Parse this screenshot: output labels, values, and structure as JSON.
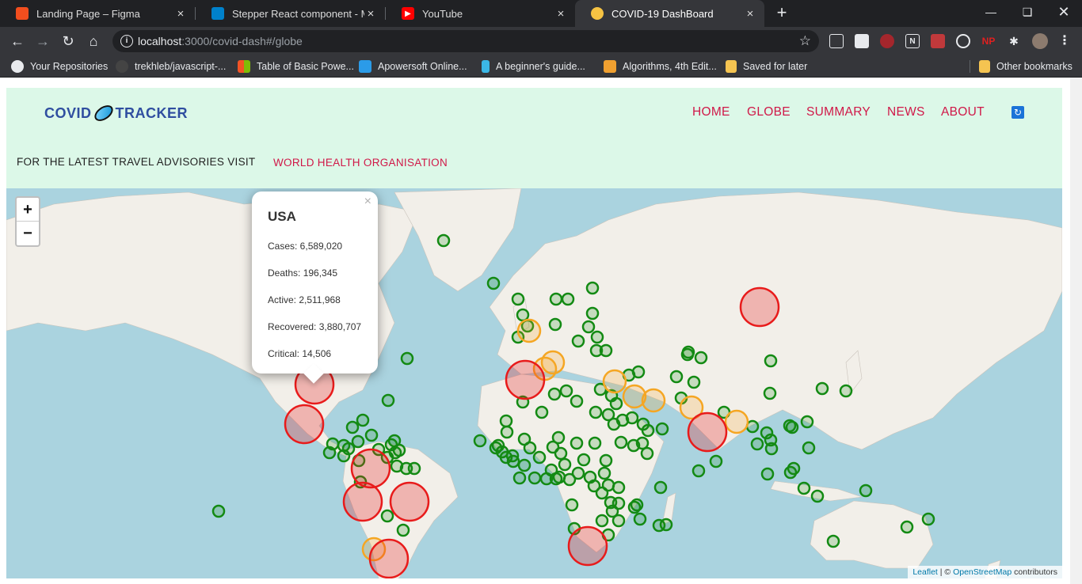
{
  "browser": {
    "tabs": [
      {
        "title": "Landing Page – Figma",
        "icon": "figma-icon",
        "color": "#f24e1e"
      },
      {
        "title": "Stepper React component - Mate",
        "icon": "material-ui-icon",
        "color": "#0081cb"
      },
      {
        "title": "YouTube",
        "icon": "youtube-icon",
        "color": "#ff0000"
      },
      {
        "title": "COVID-19 DashBoard",
        "icon": "mask-emoji-icon",
        "color": "#f6c343",
        "active": true
      }
    ],
    "close_glyph": "×",
    "new_tab_glyph": "+",
    "url_host": "localhost",
    "url_rest": ":3000/covid-dash#/globe"
  },
  "bookmarks": [
    {
      "label": "Your Repositories",
      "icon": "github-icon",
      "color": "#e8eaed"
    },
    {
      "label": "trekhleb/javascript-...",
      "icon": "github-icon",
      "color": "#e8eaed"
    },
    {
      "label": "Table of Basic Powe...",
      "icon": "microsoft-icon",
      "color": "#f35325"
    },
    {
      "label": "Apowersoft Online...",
      "icon": "camera-icon",
      "color": "#2b9be8"
    },
    {
      "label": "A beginner's guide...",
      "icon": "bottle-icon",
      "color": "#3bb7e6"
    },
    {
      "label": "Algorithms, 4th Edit...",
      "icon": "cat-icon",
      "color": "#f0a030"
    },
    {
      "label": "Saved for later",
      "icon": "folder-icon",
      "color": "#f5c451"
    },
    {
      "label": "Other bookmarks",
      "icon": "folder-icon",
      "color": "#f5c451"
    }
  ],
  "app": {
    "logo_left": "COVID",
    "logo_right": "TRACKER",
    "nav": [
      "HOME",
      "GLOBE",
      "SUMMARY",
      "NEWS",
      "ABOUT"
    ],
    "advisory_text": "FOR THE LATEST TRAVEL ADVISORIES VISIT",
    "advisory_link": "WORLD HEALTH ORGANISATION",
    "colors": {
      "header_bg": "#dcf8e8",
      "nav": "#d01848",
      "logo": "#2f4ea0",
      "ocean": "#aad3df",
      "land": "#f2efe9"
    }
  },
  "map": {
    "zoom_in": "+",
    "zoom_out": "−",
    "popup": {
      "country": "USA",
      "close": "×",
      "lines": [
        "Cases: 6,589,020",
        "Deaths: 196,345",
        "Active: 2,511,968",
        "Recovered: 3,880,707",
        "Critical: 14,506"
      ]
    },
    "attribution": {
      "leaflet": "Leaflet",
      "sep": " | © ",
      "osm": "OpenStreetMap",
      "tail": " contributors"
    },
    "marker_colors": {
      "high": "#e81b1b",
      "medium": "#f5a623",
      "low": "#138a13"
    }
  }
}
